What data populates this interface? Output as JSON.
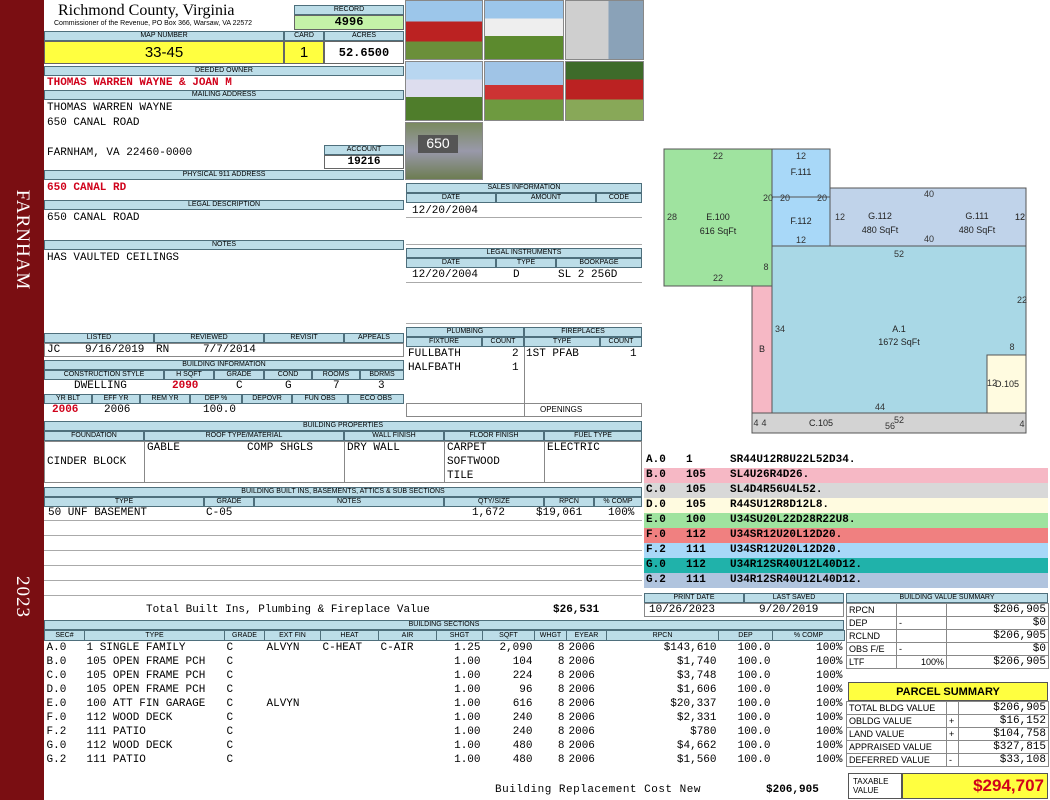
{
  "side": {
    "city": "FARNHAM",
    "year": "2023"
  },
  "header": {
    "county": "Richmond County, Virginia",
    "commissioner": "Commissioner of the Revenue, PO Box 366, Warsaw, VA 22572",
    "record_label": "RECORD",
    "record": "4996",
    "map_label": "MAP NUMBER",
    "map": "33-45",
    "card_label": "CARD",
    "card": "1",
    "acres_label": "ACRES",
    "acres": "52.6500"
  },
  "owner": {
    "label": "DEEDED OWNER",
    "name": "THOMAS WARREN WAYNE & JOAN M",
    "mail_label": "MAILING ADDRESS",
    "mail1": "THOMAS WARREN WAYNE",
    "mail2": "650 CANAL ROAD",
    "mail3": "FARNHAM, VA 22460-0000",
    "account_label": "ACCOUNT",
    "account": "19216"
  },
  "address": {
    "label": "PHYSICAL 911 ADDRESS",
    "value": "650 CANAL RD"
  },
  "legal": {
    "label": "LEGAL DESCRIPTION",
    "value": "650 CANAL ROAD"
  },
  "notes": {
    "label": "NOTES",
    "value": "HAS VAULTED CEILINGS"
  },
  "sales": {
    "label": "SALES INFORMATION",
    "cols": [
      "DATE",
      "AMOUNT",
      "CODE"
    ],
    "date": "12/20/2004"
  },
  "instruments": {
    "label": "LEGAL INSTRUMENTS",
    "cols": [
      "DATE",
      "TYPE",
      "BOOKPAGE"
    ],
    "date": "12/20/2004",
    "type": "D",
    "book": "SL 2 256D"
  },
  "listing": {
    "cols": [
      "LISTED",
      "REVIEWED",
      "REVISIT",
      "APPEALS"
    ],
    "l_by": "JC",
    "l_date": "9/16/2019",
    "r_by": "RN",
    "r_date": "7/7/2014"
  },
  "plumbing": {
    "label": "PLUMBING",
    "cols": [
      "FIXTURE",
      "COUNT"
    ],
    "rows": [
      [
        "FULLBATH",
        "2"
      ],
      [
        "HALFBATH",
        "1"
      ]
    ]
  },
  "fireplaces": {
    "label": "FIREPLACES",
    "cols": [
      "TYPE",
      "COUNT"
    ],
    "rows": [
      [
        "1ST PFAB",
        "1"
      ]
    ],
    "openings": "OPENINGS"
  },
  "building": {
    "label": "BUILDING INFORMATION",
    "cols1": [
      "CONSTRUCTION STYLE",
      "H SQFT",
      "GRADE",
      "COND",
      "ROOMS",
      "BDRMS"
    ],
    "style": "DWELLING",
    "hsqft": "2090",
    "grade": "C",
    "cond": "G",
    "rooms": "7",
    "bdrms": "3",
    "cols2": [
      "YR BLT",
      "EFF YR",
      "REM YR",
      "DEP %",
      "DEPOVR",
      "FUN OBS",
      "ECO OBS"
    ],
    "yrblt": "2006",
    "effyr": "2006",
    "dep": "100.0"
  },
  "props": {
    "label": "BUILDING PROPERTIES",
    "cols": [
      "FOUNDATION",
      "ROOF TYPE/MATERIAL",
      "WALL FINISH",
      "FLOOR FINISH",
      "FUEL TYPE"
    ],
    "foundation": "CINDER BLOCK",
    "roof1": "GABLE",
    "roof2": "COMP SHGLS",
    "wall": "DRY WALL",
    "floor": [
      "CARPET",
      "SOFTWOOD",
      "TILE"
    ],
    "fuel": "ELECTRIC"
  },
  "builtins": {
    "label": "BUILDING BUILT INS, BASEMENTS, ATTICS & SUB SECTIONS",
    "cols": [
      "TYPE",
      "GRADE",
      "NOTES",
      "QTY/SIZE",
      "RPCN",
      "% COMP"
    ],
    "row": [
      "50 UNF BASEMENT",
      "C-05",
      "",
      "1,672",
      "$19,061",
      "100%"
    ],
    "total_label": "Total Built Ins, Plumbing & Fireplace Value",
    "total": "$26,531"
  },
  "sections": {
    "label": "BUILDING SECTIONS",
    "cols": [
      "SEC#",
      "TYPE",
      "GRADE",
      "EXT FIN",
      "HEAT",
      "AIR",
      "SHGT",
      "SQFT",
      "WHGT",
      "EYEAR",
      "RPCN",
      "DEP",
      "% COMP"
    ],
    "rows": [
      [
        "A.0",
        "1 SINGLE FAMILY",
        "C",
        "ALVYN",
        "C-HEAT",
        "C-AIR",
        "1.25",
        "2,090",
        "8",
        "2006",
        "$143,610",
        "100.0",
        "100%"
      ],
      [
        "B.0",
        "105 OPEN FRAME PCH",
        "C",
        "",
        "",
        "",
        "1.00",
        "104",
        "8",
        "2006",
        "$1,740",
        "100.0",
        "100%"
      ],
      [
        "C.0",
        "105 OPEN FRAME PCH",
        "C",
        "",
        "",
        "",
        "1.00",
        "224",
        "8",
        "2006",
        "$3,748",
        "100.0",
        "100%"
      ],
      [
        "D.0",
        "105 OPEN FRAME PCH",
        "C",
        "",
        "",
        "",
        "1.00",
        "96",
        "8",
        "2006",
        "$1,606",
        "100.0",
        "100%"
      ],
      [
        "E.0",
        "100 ATT FIN GARAGE",
        "C",
        "ALVYN",
        "",
        "",
        "1.00",
        "616",
        "8",
        "2006",
        "$20,337",
        "100.0",
        "100%"
      ],
      [
        "F.0",
        "112 WOOD DECK",
        "C",
        "",
        "",
        "",
        "1.00",
        "240",
        "8",
        "2006",
        "$2,331",
        "100.0",
        "100%"
      ],
      [
        "F.2",
        "111 PATIO",
        "C",
        "",
        "",
        "",
        "1.00",
        "240",
        "8",
        "2006",
        "$780",
        "100.0",
        "100%"
      ],
      [
        "G.0",
        "112 WOOD DECK",
        "C",
        "",
        "",
        "",
        "1.00",
        "480",
        "8",
        "2006",
        "$4,662",
        "100.0",
        "100%"
      ],
      [
        "G.2",
        "111 PATIO",
        "C",
        "",
        "",
        "",
        "1.00",
        "480",
        "8",
        "2006",
        "$1,560",
        "100.0",
        "100%"
      ]
    ],
    "replacement_label": "Building Replacement Cost New",
    "replacement": "$206,905"
  },
  "print": {
    "cols": [
      "PRINT DATE",
      "LAST SAVED"
    ],
    "print_date": "10/26/2023",
    "last_saved": "9/20/2019"
  },
  "summary": {
    "label": "BUILDING VALUE SUMMARY",
    "rows": [
      [
        "RPCN",
        "",
        "$206,905"
      ],
      [
        "DEP",
        "-",
        "$0"
      ],
      [
        "RCLND",
        "",
        "$206,905"
      ],
      [
        "OBS F/E",
        "-",
        "$0"
      ],
      [
        "LTF",
        "100%",
        "$206,905"
      ]
    ]
  },
  "parcel": {
    "label": "PARCEL SUMMARY",
    "rows": [
      [
        "TOTAL BLDG VALUE",
        "",
        "$206,905"
      ],
      [
        "OBLDG VALUE",
        "+",
        "$16,152"
      ],
      [
        "LAND VALUE",
        "+",
        "$104,758"
      ],
      [
        "APPRAISED VALUE",
        "",
        "$327,815"
      ],
      [
        "DEFERRED VALUE",
        "-",
        "$33,108"
      ]
    ],
    "taxable_label1": "TAXABLE",
    "taxable_label2": "VALUE",
    "taxable": "$294,707"
  },
  "sketch": {
    "labels": {
      "e": "E.100",
      "e_area": "616 SqFt",
      "f111": "F.111",
      "f112": "F.112",
      "g112": "G.112",
      "g112_area": "480 SqFt",
      "g111": "G.111",
      "g111_area": "480 SqFt",
      "a": "A.1",
      "a_area": "1672 SqFt",
      "b": "B",
      "c": "C.105",
      "d": "D.105"
    },
    "dims": [
      "22",
      "12",
      "20",
      "20",
      "20",
      "28",
      "12",
      "12",
      "40",
      "12",
      "40",
      "12",
      "52",
      "8",
      "22",
      "22",
      "34",
      "8",
      "12",
      "44",
      "4",
      "4",
      "52",
      "56",
      "4"
    ],
    "colors": {
      "e": "#9fe39f",
      "f": "#a8d8f8",
      "g": "#c0d3ea",
      "a": "#a9d8e6",
      "b": "#f6b8c5",
      "c": "#d3d3d3",
      "d": "#fffbe0"
    }
  },
  "sequences": [
    {
      "sec": "A.0",
      "code": "1",
      "seq": "SR44U12R8U22L52D34.",
      "color": "#ffffff"
    },
    {
      "sec": "B.0",
      "code": "105",
      "seq": "SL4U26R4D26.",
      "color": "#f6b8c5"
    },
    {
      "sec": "C.0",
      "code": "105",
      "seq": "SL4D4R56U4L52.",
      "color": "#d8d8d8"
    },
    {
      "sec": "D.0",
      "code": "105",
      "seq": "R44SU12R8D12L8.",
      "color": "#fffbe0"
    },
    {
      "sec": "E.0",
      "code": "100",
      "seq": "U34SU20L22D28R22U8.",
      "color": "#9fe39f"
    },
    {
      "sec": "F.0",
      "code": "112",
      "seq": "U34SR12U20L12D20.",
      "color": "#f08080"
    },
    {
      "sec": "F.2",
      "code": "111",
      "seq": "U34SR12U20L12D20.",
      "color": "#a8d8f8"
    },
    {
      "sec": "G.0",
      "code": "112",
      "seq": "U34R12SR40U12L40D12.",
      "color": "#20b2aa"
    },
    {
      "sec": "G.2",
      "code": "111",
      "seq": "U34R12SR40U12L40D12.",
      "color": "#b0c4de"
    }
  ]
}
